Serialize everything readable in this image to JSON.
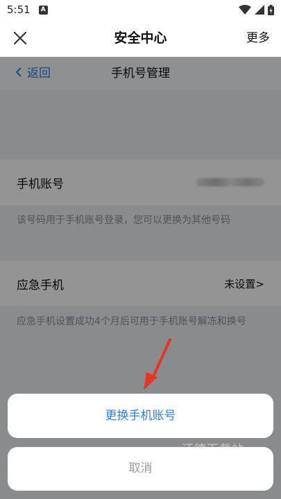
{
  "status_bar": {
    "time": "5:51",
    "notification_letter": "A",
    "icons": [
      "wifi-icon",
      "signal-icon",
      "battery-icon"
    ]
  },
  "title_bar": {
    "title": "安全中心",
    "more_label": "更多",
    "close_icon": "close-icon"
  },
  "sub_header": {
    "back_label": "返回",
    "title": "手机号管理"
  },
  "phone_row": {
    "label": "手机账号",
    "hint": "该号码用于手机账号登录，您可以更换为其他号码"
  },
  "emergency_row": {
    "label": "应急手机",
    "value": "未设置>",
    "hint": "应急手机设置成功4个月后可用于手机账号解冻和换号"
  },
  "action_sheet": {
    "change_label": "更换手机账号",
    "cancel_label": "取消"
  },
  "colors": {
    "accent": "#2d7fe0",
    "annotation_arrow": "#e8332a"
  }
}
